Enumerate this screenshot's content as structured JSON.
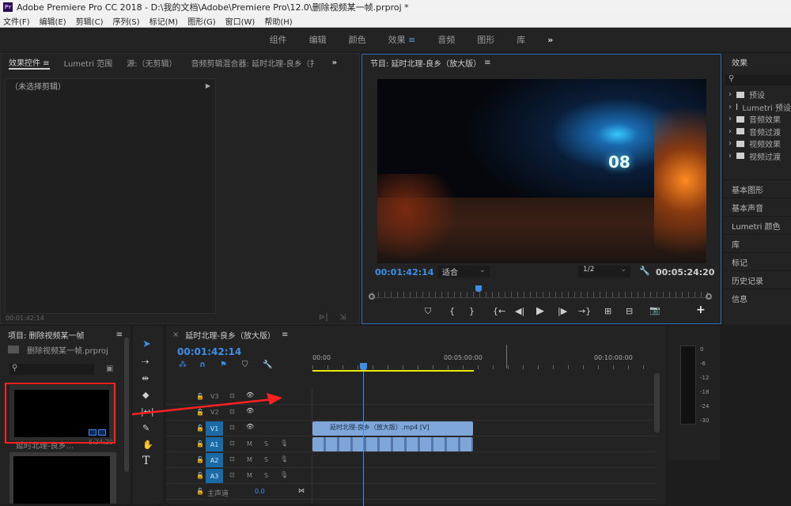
{
  "window": {
    "title": "Adobe Premiere Pro CC 2018 - D:\\我的文档\\Adobe\\Premiere Pro\\12.0\\删除视频某一帧.prproj *",
    "logo": "Pr"
  },
  "menu": [
    "文件(F)",
    "编辑(E)",
    "剪辑(C)",
    "序列(S)",
    "标记(M)",
    "图形(G)",
    "窗口(W)",
    "帮助(H)"
  ],
  "workspaces": {
    "items": [
      "组件",
      "编辑",
      "颜色",
      "效果",
      "音频",
      "图形",
      "库"
    ],
    "active": "效果",
    "more": "»"
  },
  "effect_controls": {
    "tabs": [
      "效果控件",
      "Lumetri 范围",
      "源:（无剪辑）",
      "音频剪辑混合器: 延时北理-良乡（扌"
    ],
    "more": "»",
    "no_clip": "（未选择剪辑）",
    "timecode": "00:01:42:14"
  },
  "program": {
    "title": "节目: 延时北理-良乡（放大版）",
    "timecode": "00:01:42:14",
    "fit": "适合",
    "resolution": "1/2",
    "duration": "00:05:24:20",
    "sign_text": "08",
    "playhead_fraction": 0.315
  },
  "effects_panel": {
    "title": "效果",
    "search_placeholder": "",
    "items": [
      "预设",
      "Lumetri 预设",
      "音频效果",
      "音频过渡",
      "视频效果",
      "视频过渡"
    ]
  },
  "right_panels": [
    "基本图形",
    "基本声音",
    "Lumetri 颜色",
    "库",
    "标记",
    "历史记录",
    "信息"
  ],
  "project": {
    "title": "项目: 删除视频某一帧",
    "file": "删除视频某一帧.prproj",
    "clip_name": "延时北理-良乡...",
    "clip_duration": "5:24:20"
  },
  "timeline": {
    "title": "延时北理-良乡（放大版）",
    "timecode": "00:01:42:14",
    "ruler": [
      "00:00",
      "00:05:00:00",
      "00:10:00:00"
    ],
    "video_tracks": [
      "V3",
      "V2",
      "V1"
    ],
    "audio_tracks": [
      "A1",
      "A2",
      "A3"
    ],
    "master": {
      "label": "主声道",
      "value": "0.0"
    },
    "clip_label": "延时北理-良乡（放大版）.mp4 [V]",
    "mute": "M",
    "solo": "S"
  },
  "meter": {
    "scale": [
      "0",
      "-6",
      "-12",
      "-18",
      "-24",
      "-30"
    ]
  },
  "colors": {
    "accent": "#3d8ee6",
    "highlight": "#ff2020",
    "clip": "#7ea6d8",
    "work_area": "#e8e800"
  }
}
